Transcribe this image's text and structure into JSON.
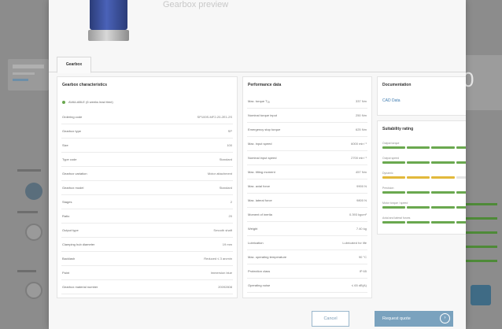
{
  "background": {
    "left_panel_title": "Global Appl",
    "big_number": "0"
  },
  "product": {
    "title": "Gearbox preview"
  },
  "tabs": [
    {
      "label": "Gearbox"
    }
  ],
  "characteristics": {
    "title": "Gearbox characteristics",
    "availability": "AVAILABLE (6 weeks lead time)",
    "rows": [
      {
        "label": "Ordering code",
        "value": "SP100S-MF2-20-2E1-2S"
      },
      {
        "label": "Gearbox type",
        "value": "SP"
      },
      {
        "label": "Size",
        "value": "100"
      },
      {
        "label": "Type code",
        "value": "Standard"
      },
      {
        "label": "Gearbox variation",
        "value": "Motor attachment"
      },
      {
        "label": "Gearbox model",
        "value": "Standard"
      },
      {
        "label": "Stages",
        "value": "2"
      },
      {
        "label": "Ratio",
        "value": "20"
      },
      {
        "label": "Output type",
        "value": "Smooth shaft"
      },
      {
        "label": "Clamping hub diameter",
        "value": "19 mm"
      },
      {
        "label": "Backlash",
        "value": "Reduced ≤ 3 arcmin"
      },
      {
        "label": "Paint",
        "value": "Immersion blue"
      },
      {
        "label": "Gearbox material number",
        "value": "20092808"
      }
    ]
  },
  "performance": {
    "title": "Performance data",
    "rows": [
      {
        "label": "Max. torque T₂ₐ",
        "value": "337 Nm"
      },
      {
        "label": "Nominal torque input",
        "value": "250 Nm"
      },
      {
        "label": "Emergency stop torque",
        "value": "625 Nm"
      },
      {
        "label": "Max. input speed",
        "value": "6000 min⁻¹"
      },
      {
        "label": "Nominal input speed",
        "value": "2700 min⁻¹"
      },
      {
        "label": "Max. tilting moment",
        "value": "457 Nm"
      },
      {
        "label": "Max. axial force",
        "value": "9900 N"
      },
      {
        "label": "Max. lateral force",
        "value": "9800 N"
      },
      {
        "label": "Moment of inertia",
        "value": "0.393 kgcm²"
      },
      {
        "label": "Weight",
        "value": "7.40 kg"
      },
      {
        "label": "Lubrication",
        "value": "Lubricated for life"
      },
      {
        "label": "Max. operating temperature",
        "value": "90 °C"
      },
      {
        "label": "Protection class",
        "value": "IP 65"
      },
      {
        "label": "Operating noise",
        "value": "≤ 65 dB(A)"
      }
    ]
  },
  "documentation": {
    "title": "Documentation",
    "link": "CAD Data",
    "chevron": "›"
  },
  "suitability": {
    "title": "Suitability rating",
    "colors": {
      "good": "#6aa84f",
      "medium": "#e2b93b",
      "empty": "#e4e4e4"
    },
    "items": [
      {
        "label": "Output torque",
        "level": 5,
        "tone": "good"
      },
      {
        "label": "Output speed",
        "level": 4,
        "tone": "good"
      },
      {
        "label": "Dynamic",
        "level": 3,
        "tone": "medium"
      },
      {
        "label": "Precision",
        "level": 5,
        "tone": "good"
      },
      {
        "label": "Motor torque / speed",
        "level": 4,
        "tone": "good"
      },
      {
        "label": "Axial and lateral forces",
        "level": 5,
        "tone": "good"
      }
    ]
  },
  "footer": {
    "cancel": "Cancel",
    "request": "Request quote",
    "request_icon": "›"
  }
}
